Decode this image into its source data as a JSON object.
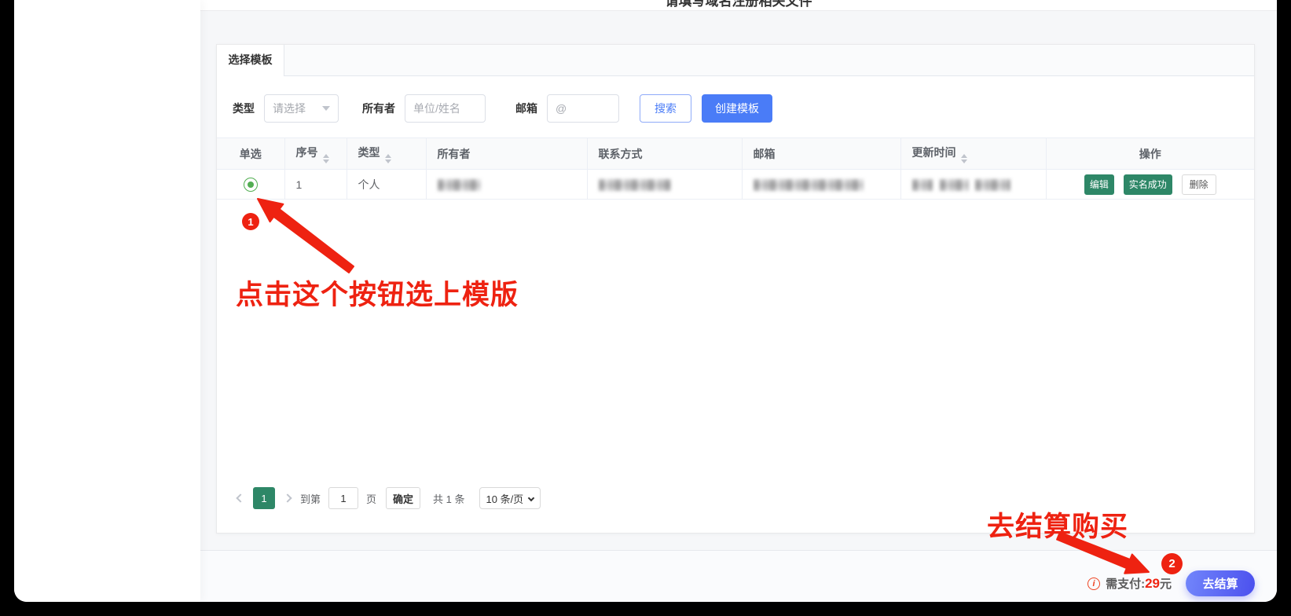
{
  "window": {
    "clipped_title": "请填写域名注册相关文件"
  },
  "tabs": {
    "active": "选择模板"
  },
  "filters": {
    "type_label": "类型",
    "type_value": "请选择",
    "owner_label": "所有者",
    "owner_placeholder": "单位/姓名",
    "email_label": "邮箱",
    "email_placeholder": "@",
    "search_button": "搜索",
    "create_button": "创建模板"
  },
  "table": {
    "columns": [
      "单选",
      "序号",
      "类型",
      "所有者",
      "联系方式",
      "邮箱",
      "更新时间",
      "操作"
    ],
    "row": {
      "index": "1",
      "type": "个人",
      "actions": {
        "edit": "编辑",
        "verified": "实名成功",
        "delete": "删除"
      }
    }
  },
  "pagination": {
    "current_page": "1",
    "goto_label": "到第",
    "goto_value": "1",
    "page_label": "页",
    "confirm_button": "确定",
    "total_text": "共 1 条",
    "page_size": "10 条/页"
  },
  "footer": {
    "pay_label": "需支付:",
    "pay_amount": "29",
    "pay_unit": "元",
    "checkout_button": "去结算"
  },
  "annotations": {
    "step1_badge": "1",
    "step1_text": "点击这个按钮选上模版",
    "step2_badge": "2",
    "step2_text": "去结算购买"
  },
  "colors": {
    "accent_blue": "#4a7cf7",
    "teal_green": "#2e8767",
    "radio_green": "#52ae52",
    "annotation_red": "#ee2211",
    "price_red": "#f02311",
    "checkout_gradient_start": "#7286fb",
    "checkout_gradient_end": "#4b50ee"
  }
}
